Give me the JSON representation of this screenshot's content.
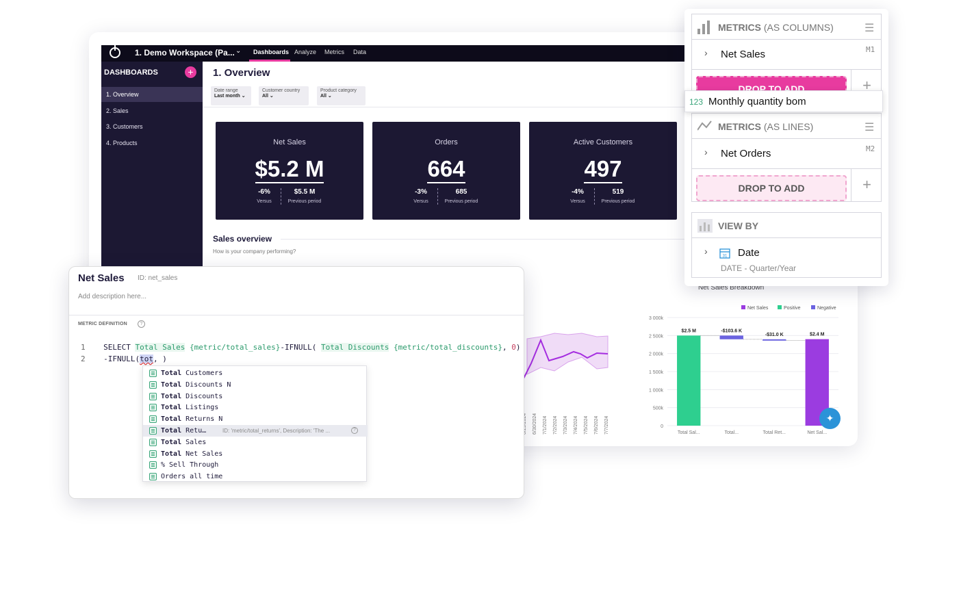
{
  "topbar": {
    "workspace": "1. Demo Workspace (Pa...",
    "nav": [
      "Dashboards",
      "Analyze",
      "Metrics",
      "Data"
    ]
  },
  "sidebar": {
    "header": "DASHBOARDS",
    "add": "+",
    "items": [
      "1. Overview",
      "2. Sales",
      "3. Customers",
      "4. Products"
    ]
  },
  "main": {
    "title": "1. Overview",
    "filters": [
      {
        "label": "Date range",
        "value": "Last month"
      },
      {
        "label": "Customer country",
        "value": "All"
      },
      {
        "label": "Product category",
        "value": "All"
      }
    ],
    "kpis": [
      {
        "title": "Net Sales",
        "value": "$5.2 M",
        "delta": "-6%",
        "delta_label": "Versus",
        "prev": "$5.5 M",
        "prev_label": "Previous period"
      },
      {
        "title": "Orders",
        "value": "664",
        "delta": "-3%",
        "delta_label": "Versus",
        "prev": "685",
        "prev_label": "Previous period"
      },
      {
        "title": "Active Customers",
        "value": "497",
        "delta": "-4%",
        "delta_label": "Versus",
        "prev": "519",
        "prev_label": "Previous period"
      }
    ],
    "section_title": "Sales overview",
    "section_sub": "How is your company performing?"
  },
  "line_chart": {
    "x_dates": [
      "6/29/2024",
      "6/30/2024",
      "7/1/2024",
      "7/2/2024",
      "7/3/2024",
      "7/4/2024",
      "7/5/2024",
      "7/6/2024",
      "7/7/2024"
    ]
  },
  "chart_data": {
    "type": "bar",
    "title": "Net Sales Breakdown",
    "legend": [
      "Net Sales",
      "Positive",
      "Negative"
    ],
    "legend_colors": [
      "#9b3ce0",
      "#2ecf8f",
      "#6b63e0"
    ],
    "yticks": [
      "3 000k",
      "2 500k",
      "2 000k",
      "1 500k",
      "1 000k",
      "500k",
      "0"
    ],
    "ylim": [
      0,
      3000000
    ],
    "categories": [
      "Total Sales",
      "Total Discounts",
      "Total Returns",
      "Net Sales"
    ],
    "x_labels_visible": [
      "Total Sal...",
      "Total...",
      "Total Ret...",
      "Net Sal..."
    ],
    "bars": [
      {
        "label": "$2.5 M",
        "start": 0,
        "end": 2500000,
        "color": "#2ecf8f"
      },
      {
        "label": "-$103.6 K",
        "start": 2396400,
        "end": 2500000,
        "color": "#6b63e0"
      },
      {
        "label": "-$31.0 K",
        "start": 2365400,
        "end": 2396400,
        "color": "#6b63e0"
      },
      {
        "label": "$2.4 M",
        "start": 0,
        "end": 2400000,
        "color": "#9b3ce0"
      }
    ]
  },
  "editor": {
    "title": "Net Sales",
    "id": "ID: net_sales",
    "description": "Add description here...",
    "section": "METRIC DEFINITION",
    "help": "?",
    "code": {
      "line1_num": "1",
      "line1_kw": "SELECT ",
      "line1_t1": "Total Sales",
      "line1_r1": " {metric/total_sales}",
      "line1_m1": "-IFNULL( ",
      "line1_t2": "Total Discounts",
      "line1_r2": " {metric/total_discounts}",
      "line1_m2": ", ",
      "line1_zero": "0",
      "line1_end": ")",
      "line2_num": "2",
      "line2_pre": "-IFNULL(",
      "line2_typed": "tot",
      "line2_post": ", )"
    },
    "autocomplete": [
      {
        "match": "Total",
        "rest": " Customers"
      },
      {
        "match": "Total",
        "rest": " Discounts N"
      },
      {
        "match": "Total",
        "rest": " Discounts"
      },
      {
        "match": "Total",
        "rest": " Listings"
      },
      {
        "match": "Total",
        "rest": " Returns N"
      },
      {
        "match": "Total",
        "rest": " Retu…",
        "detail": "ID: 'metric/total_returns', Description: 'The ...",
        "selected": true
      },
      {
        "match": "Total",
        "rest": " Sales"
      },
      {
        "match": "Total",
        "rest": " Net Sales"
      },
      {
        "match": "",
        "rest": "% Sell Through"
      },
      {
        "match": "",
        "rest": "Orders all time"
      }
    ]
  },
  "panel": {
    "metrics_columns": {
      "title": "METRICS",
      "suffix": " (AS COLUMNS)",
      "item": "Net Sales",
      "tag": "M1",
      "drop": "DROP TO ADD"
    },
    "dragging": {
      "icon": "123",
      "label": "Monthly quantity bom"
    },
    "metrics_lines": {
      "title": "METRICS",
      "suffix": " (AS LINES)",
      "item": "Net Orders",
      "tag": "M2",
      "drop": "DROP TO ADD"
    },
    "view_by": {
      "title": "VIEW BY",
      "item": "Date",
      "sub": "DATE - Quarter/Year"
    },
    "plus": "+"
  },
  "icons": {
    "menu": "hamburger-icon",
    "chevron": "chevron-right-icon",
    "calendar": "calendar-icon",
    "magic": "magic-wand-icon"
  }
}
